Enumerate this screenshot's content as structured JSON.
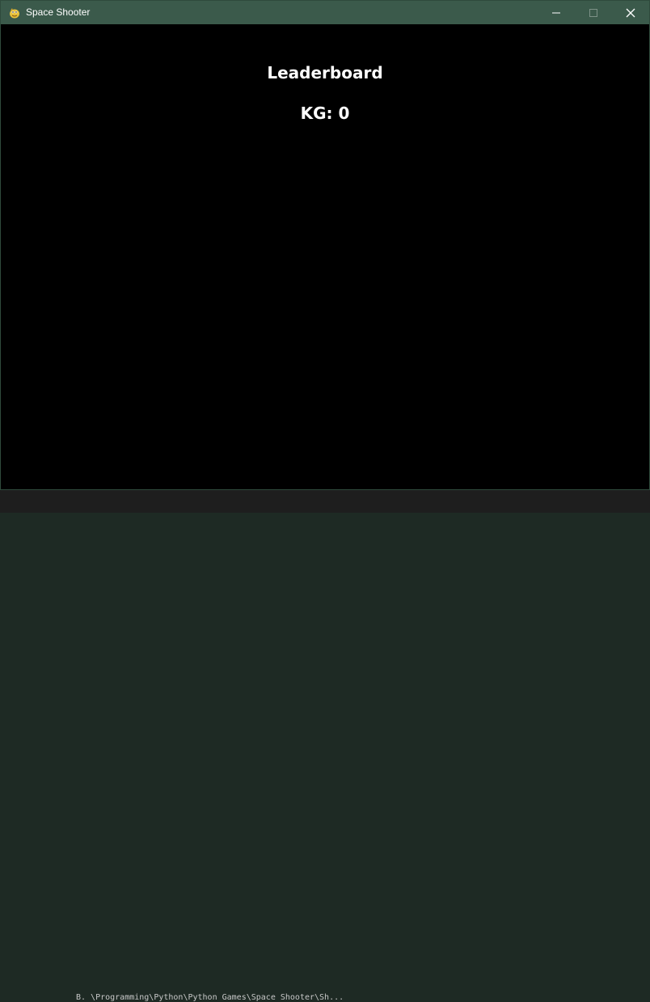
{
  "window": {
    "title": "Space Shooter",
    "app_icon": "pygame-snake-icon",
    "controls": {
      "minimize_icon": "minimize-icon",
      "maximize_icon": "maximize-icon",
      "close_icon": "close-icon"
    }
  },
  "game": {
    "heading": "Leaderboard",
    "score_line": "KG: 0"
  },
  "background": {
    "terminal_line": "B. \\Programming\\Python\\Python Games\\Space Shooter\\Sh..."
  },
  "colors": {
    "titlebar": "#3b5a4b",
    "canvas": "#000000",
    "text": "#ffffff"
  }
}
